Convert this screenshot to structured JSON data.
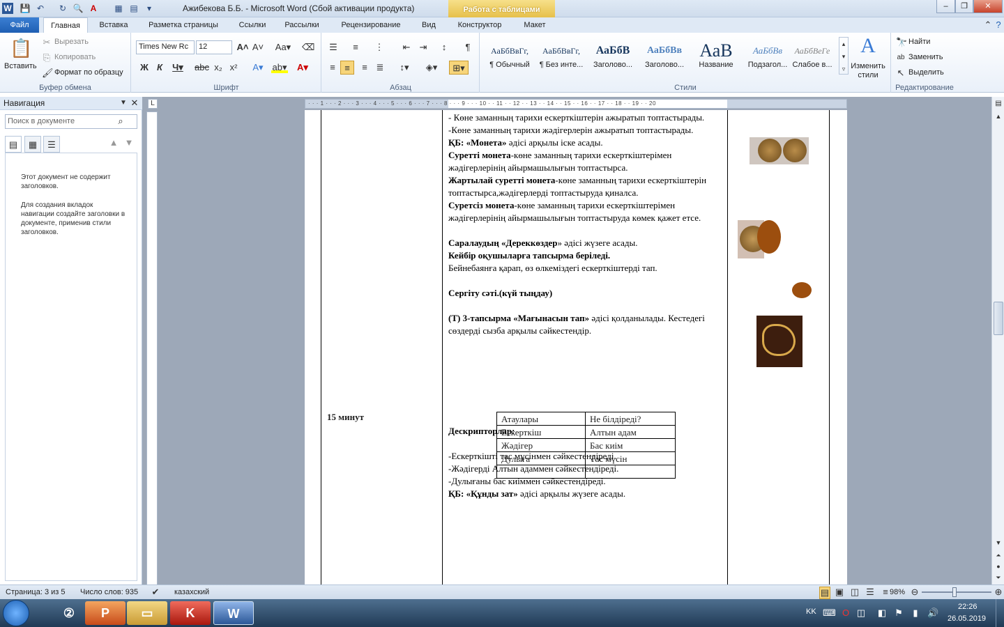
{
  "window": {
    "title": "Ажибекова Б.Б.  -  Microsoft Word (Сбой активации продукта)",
    "context_tab": "Работа с таблицами",
    "minimize": "–",
    "restore": "❐",
    "close": "✕"
  },
  "tabs": [
    "Файл",
    "Главная",
    "Вставка",
    "Разметка страницы",
    "Ссылки",
    "Рассылки",
    "Рецензирование",
    "Вид",
    "Конструктор",
    "Макет"
  ],
  "ribbon": {
    "clipboard": {
      "paste": "Вставить",
      "cut": "Вырезать",
      "copy": "Копировать",
      "format_painter": "Формат по образцу",
      "label": "Буфер обмена"
    },
    "font": {
      "name": "Times New Rc",
      "size": "12",
      "label": "Шрифт"
    },
    "paragraph": {
      "label": "Абзац"
    },
    "styles": {
      "label": "Стили",
      "items": [
        {
          "preview": "АаБбВвГг,",
          "name": "¶ Обычный"
        },
        {
          "preview": "АаБбВвГг,",
          "name": "¶ Без инте..."
        },
        {
          "preview": "АаБбВ",
          "name": "Заголово..."
        },
        {
          "preview": "АаБбВв",
          "name": "Заголово..."
        },
        {
          "preview": "АаВ",
          "name": "Название"
        },
        {
          "preview": "АаБбВв",
          "name": "Подзагол..."
        },
        {
          "preview": "АаБбВеГе",
          "name": "Слабое в..."
        }
      ],
      "change_styles": "Изменить стили"
    },
    "editing": {
      "find": "Найти",
      "replace": "Заменить",
      "select": "Выделить",
      "label": "Редактирование"
    }
  },
  "nav": {
    "title": "Навигация",
    "search_placeholder": "Поиск в документе",
    "msg1": "Этот документ не содержит заголовков.",
    "msg2": "Для создания вкладок навигации создайте заголовки в документе, применив стили заголовков."
  },
  "doc": {
    "lines": [
      {
        "t": "- Көне заманның тарихи ескерткіштерін   ажыратып топтастырады."
      },
      {
        "t": "-Көне заманның тарихи жәдігерлерін ажыратып топтастырады."
      },
      {
        "b": "ҚБ: «Монета»",
        "t": " әдісі арқылы іске  асады."
      },
      {
        "b": "Суретті монета",
        "t": "-көне заманның тарихи ескерткіштерімен жәдігерлерінің  айырмашылығын топтастырса."
      },
      {
        "b": "Жартылай суретті монета",
        "t": "-көне заманның тарихи ескерткіштерін  топтастырса,жәдігерлерді топтастыруда қиналса."
      },
      {
        "b": "Суретсіз монета",
        "t": "-көне заманның тарихи ескерткіштерімен жәдігерлерінің  айырмашылығын топтастыруда көмек қажет етсе."
      },
      {
        "t": ""
      },
      {
        "b": "Саралаудың «Дереккөздер",
        "t": "» әдісі жүзеге асады."
      },
      {
        "b": " Кейбір оқушыларға тапсырма беріледі.",
        "t": ""
      },
      {
        "t": " Бейнебаянға  қарап, өз өлкеміздегі  ескерткіштерді  тап."
      },
      {
        "t": ""
      },
      {
        "b": "Сергіту сәті.(күй тыңдау)",
        "t": ""
      },
      {
        "t": ""
      },
      {
        "b": "(Т) 3-тапсырма «Мағынасын тап»",
        "t": " әдісі қолданылады. Кестедегі сөздерді сызба арқылы сәйкестендір."
      }
    ],
    "time_label": "15 минут",
    "table": [
      [
        "Атаулары",
        "Не білдіреді?"
      ],
      [
        "Ескерткіш",
        "Алтын адам"
      ],
      [
        "Жәдігер",
        "Бас киім"
      ],
      [
        "Дулыға",
        "Тас мүсін"
      ],
      [
        "",
        ""
      ]
    ],
    "lines2": [
      {
        "b": "Дескрипторлар:",
        "t": ""
      },
      {
        "t": ""
      },
      {
        "t": "-Ескерткішті   тас мүсінмен сәйкестендіреді."
      },
      {
        "t": "-Жәдігерді  Алтын адаммен сәйкестендіреді."
      },
      {
        "t": "-Дулығаны бас киіммен сәйкестендіреді."
      },
      {
        "b": "ҚБ: «Құнды зат»",
        "t": " әдісі  арқылы жүзеге асады."
      }
    ]
  },
  "status": {
    "page": "Страница: 3 из 5",
    "words": "Число слов: 935",
    "lang": "казахский",
    "zoom": "98%"
  },
  "tray": {
    "lang": "KK",
    "time": "22:26",
    "date": "26.05.2019"
  }
}
